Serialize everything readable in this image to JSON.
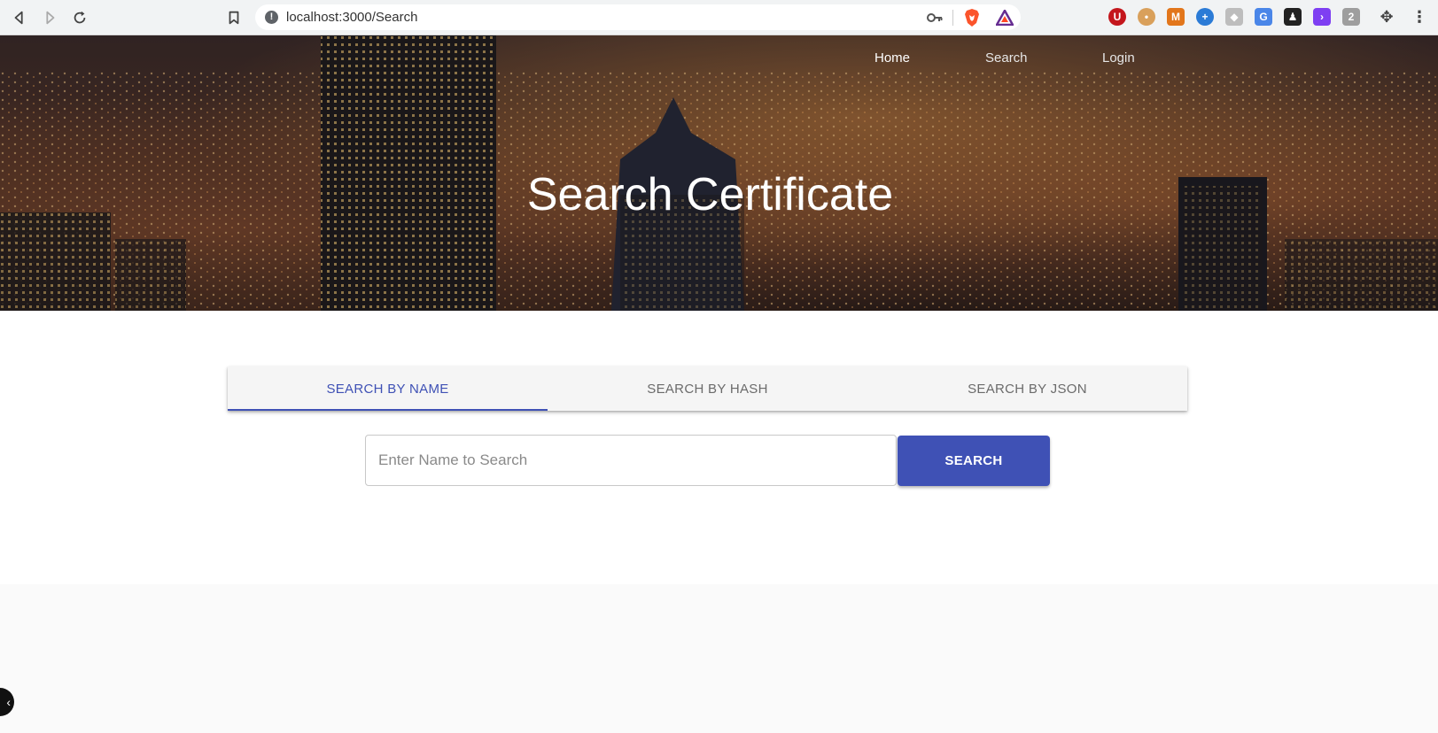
{
  "browser": {
    "url": "localhost:3000/Search",
    "icons": [
      "back-icon",
      "forward-icon",
      "reload-icon",
      "bookmark-icon",
      "site-info-icon",
      "key-icon",
      "brave-shields-icon",
      "brave-rewards-icon"
    ],
    "extensions": [
      "ublock-icon",
      "cookie-icon",
      "metamask-icon",
      "dapp-icon",
      "ethereum-icon",
      "google-translate-icon",
      "incognito-extension-icon",
      "terminal-extension-icon",
      "grey-extension-icon",
      "puzzle-icon",
      "more-menu-icon"
    ]
  },
  "nav": {
    "home": "Home",
    "search": "Search",
    "login": "Login"
  },
  "hero": {
    "title": "Search Certificate"
  },
  "tabs": [
    {
      "label": "SEARCH BY NAME",
      "active": true
    },
    {
      "label": "SEARCH BY HASH",
      "active": false
    },
    {
      "label": "SEARCH BY JSON",
      "active": false
    }
  ],
  "search": {
    "placeholder": "Enter Name to Search",
    "value": "",
    "button_label": "SEARCH"
  },
  "colors": {
    "primary": "#3f51b5",
    "tab_bar": "#f5f5f5",
    "page_bg": "#fafafa"
  }
}
